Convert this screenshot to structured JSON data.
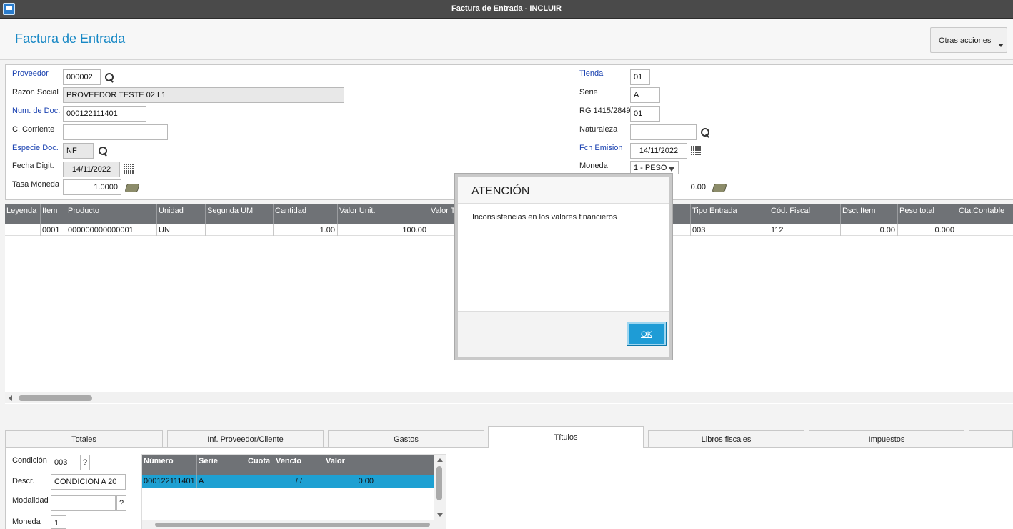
{
  "window": {
    "title": "Factura de Entrada - INCLUIR"
  },
  "header": {
    "page_title": "Factura de Entrada",
    "actions_label": "Otras acciones"
  },
  "form": {
    "proveedor": {
      "label": "Proveedor",
      "value": "000002"
    },
    "razon_social": {
      "label": "Razon Social",
      "value": "PROVEEDOR TESTE 02 L1"
    },
    "num_doc": {
      "label": "Num. de Doc.",
      "value": "000122111401"
    },
    "c_corriente": {
      "label": "C. Corriente",
      "value": ""
    },
    "especie_doc": {
      "label": "Especie Doc.",
      "value": "NF"
    },
    "fecha_digit": {
      "label": "Fecha Digit.",
      "value": "14/11/2022"
    },
    "tasa_moneda": {
      "label": "Tasa Moneda",
      "value": "1.0000"
    },
    "tienda": {
      "label": "Tienda",
      "value": "01"
    },
    "serie": {
      "label": "Serie",
      "value": "A"
    },
    "rg": {
      "label": "RG 1415/2849",
      "value": "01"
    },
    "naturaleza": {
      "label": "Naturaleza",
      "value": ""
    },
    "fch_emision": {
      "label": "Fch Emision",
      "value": "14/11/2022"
    },
    "moneda": {
      "label": "Moneda",
      "value": "1 - PESO"
    },
    "hidden_value": {
      "value": "0.00"
    }
  },
  "items_grid": {
    "columns": [
      "Leyenda",
      "Item",
      "Producto",
      "Unidad",
      "Segunda UM",
      "Cantidad",
      "Valor Unit.",
      "Valor T",
      "Tipo Entrada",
      "Cód. Fiscal",
      "Dsct.Item",
      "Peso total",
      "Cta.Contable"
    ],
    "rows": [
      {
        "leyenda": "",
        "item": "0001",
        "producto": "000000000000001",
        "unidad": "UN",
        "segunda_um": "",
        "cantidad": "1.00",
        "valor_unit": "100.00",
        "tipo_entrada": "003",
        "cod_fiscal": "112",
        "dsct_item": "0.00",
        "peso_total": "0.000",
        "cta_contable": ""
      }
    ]
  },
  "tabs": [
    "Totales",
    "Inf. Proveedor/Cliente",
    "Gastos",
    "Títulos",
    "Libros fiscales",
    "Impuestos"
  ],
  "titulos": {
    "condicion": {
      "label": "Condición",
      "value": "003",
      "help": "?"
    },
    "descr": {
      "label": "Descr.",
      "value": "CONDICION A 20"
    },
    "modalidad": {
      "label": "Modalidad",
      "value": "",
      "help": "?"
    },
    "moneda": {
      "label": "Moneda",
      "value": "1"
    },
    "grid": {
      "columns": [
        "Número",
        "Serie",
        "Cuota",
        "Vencto",
        "Valor"
      ],
      "rows": [
        {
          "numero": "000122111401",
          "serie": "A",
          "cuota": "",
          "vencto": "/ /",
          "valor": "0.00"
        }
      ]
    }
  },
  "dialog": {
    "title": "ATENCIÓN",
    "message": "Inconsistencias en los valores financieros",
    "ok_label": "OK"
  }
}
